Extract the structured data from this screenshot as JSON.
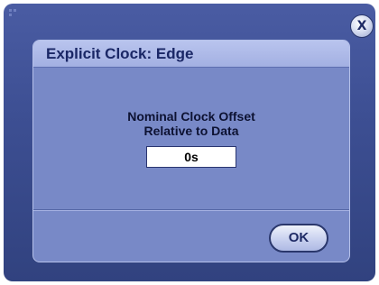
{
  "dialog": {
    "title": "Explicit Clock: Edge",
    "close_label": "X",
    "field_label_line1": "Nominal Clock Offset",
    "field_label_line2": "Relative to Data",
    "field_value": "0s",
    "ok_label": "OK"
  },
  "icons": {
    "close": "close-icon",
    "grip": "resize-grip-icon"
  },
  "colors": {
    "frame": "#3d4f93",
    "panel": "#7889c7",
    "title_bar": "#a3b0e2",
    "title_text": "#1a2766"
  }
}
